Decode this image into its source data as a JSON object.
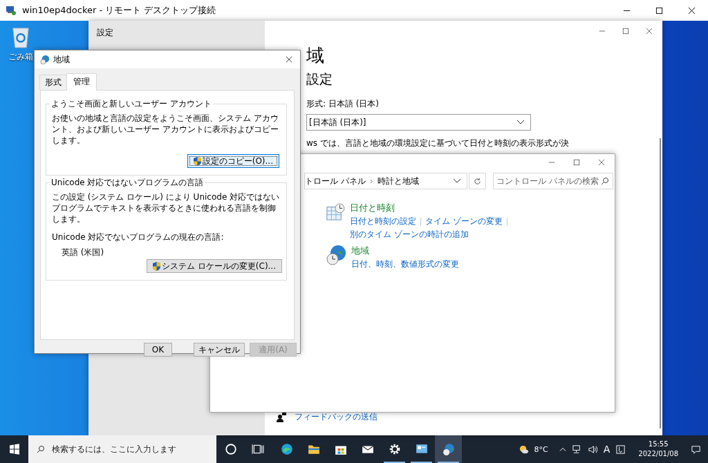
{
  "rdp_window": {
    "title": "win10ep4docker - リモート デスクトップ接続"
  },
  "desktop_icons": [
    {
      "kind": "recycle-bin",
      "label": "ごみ箱"
    }
  ],
  "settings_window": {
    "title": "設定",
    "heading": "域",
    "section_title": "設定",
    "format_label": "形式: 日本語 (日本)",
    "format_dropdown": "[日本語 (日本)]",
    "description": "ws では、言語と地域の環境設定に基づいて日付と時刻の表示形式が決",
    "feedback_link": "フィードバックの送信"
  },
  "control_panel": {
    "breadcrumb": [
      "トロール パネル",
      "時計と地域"
    ],
    "search": {
      "placeholder": "コントロール パネルの検索"
    },
    "categories": [
      {
        "kind": "clock",
        "title": "日付と時刻",
        "links": [
          "日付と時刻の設定",
          "タイム ゾーンの変更",
          "別のタイム ゾーンの時計の追加"
        ]
      },
      {
        "kind": "globe",
        "title": "地域",
        "links": [
          "日付、時刻、数値形式の変更"
        ]
      }
    ]
  },
  "region_dialog": {
    "title": "地域",
    "tabs": [
      {
        "label": "形式",
        "selected": false
      },
      {
        "label": "管理",
        "selected": true
      }
    ],
    "groups": [
      {
        "legend": "ようこそ画面と新しいユーザー アカウント",
        "text": "お使いの地域と言語の設定をようこそ画面、システム アカウント、および新しいユーザー アカウントに表示およびコピーします。",
        "button": {
          "label": "設定のコピー(O)...",
          "focused": true
        }
      },
      {
        "legend": "Unicode 対応ではないプログラムの言語",
        "text": "この設定 (システム ロケール) により Unicode 対応ではないプログラムでテキストを表示するときに使われる言語を制御します。",
        "current_label": "Unicode 対応でないプログラムの現在の言語:",
        "current_value": "英語 (米国)",
        "button": {
          "label": "システム ロケールの変更(C)...",
          "focused": false
        }
      }
    ],
    "buttons": [
      {
        "label": "OK",
        "disabled": false
      },
      {
        "label": "キャンセル",
        "disabled": false
      },
      {
        "label": "適用(A)",
        "disabled": true
      }
    ]
  },
  "taskbar": {
    "search": {
      "placeholder": "検索するには、ここに入力します"
    },
    "apps": [
      {
        "kind": "cortana",
        "running": false,
        "selected": false
      },
      {
        "kind": "taskview",
        "running": false,
        "selected": false
      },
      {
        "kind": "edge",
        "running": false,
        "selected": false
      },
      {
        "kind": "explorer",
        "running": false,
        "selected": false
      },
      {
        "kind": "store",
        "running": false,
        "selected": false
      },
      {
        "kind": "mail",
        "running": false,
        "selected": false
      },
      {
        "kind": "settings",
        "running": true,
        "selected": false
      },
      {
        "kind": "remote-desktop",
        "running": true,
        "selected": false
      },
      {
        "kind": "control-panel",
        "running": true,
        "selected": true
      }
    ],
    "weather": "8°C",
    "ime": "A",
    "time": "15:55",
    "date": "2022/01/08"
  }
}
